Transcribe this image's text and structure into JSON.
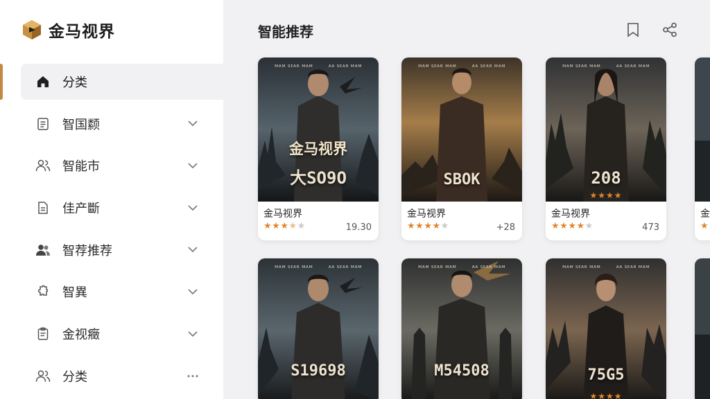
{
  "brand": {
    "name": "金马视界"
  },
  "sidebar": {
    "items": [
      {
        "label": "分类",
        "icon": "home-icon",
        "trail": "",
        "active": true
      },
      {
        "label": "智国颣",
        "icon": "document-icon",
        "trail": "chevron-down-icon"
      },
      {
        "label": "智能市",
        "icon": "users-icon",
        "trail": "chevron-down-icon"
      },
      {
        "label": "佳产斷",
        "icon": "file-icon",
        "trail": "chevron-down-icon"
      },
      {
        "label": "智荐推荐",
        "icon": "group-icon",
        "trail": "chevron-down-icon"
      },
      {
        "label": "智異",
        "icon": "puzzle-icon",
        "trail": "chevron-down-icon"
      },
      {
        "label": "金视癥",
        "icon": "clipboard-icon",
        "trail": "chevron-down-icon"
      },
      {
        "label": "分类",
        "icon": "users-icon",
        "trail": "more-icon"
      }
    ]
  },
  "main": {
    "title": "智能推荐",
    "cards": [
      {
        "title": "金马视界",
        "rating": 3.5,
        "count": "19.30",
        "poster_top_left": "ᴍᴀᴍ ꜱᴇᴀʀ ᴍᴀᴍ",
        "poster_top_right": "ᴀᴀ ꜱᴇᴀʀ ᴍᴀᴍ",
        "poster_cn": "金马视界",
        "poster_big": "大SO9O",
        "poster_stars": ""
      },
      {
        "title": "金马视界",
        "rating": 4,
        "count": "+28",
        "poster_top_left": "ᴍᴀᴍ ꜱᴇᴀʀ ᴍᴀᴍ",
        "poster_top_right": "ᴀᴀ ꜱᴇᴀʀ ᴍᴀᴍ",
        "poster_cn": "",
        "poster_big": "SBOK",
        "poster_stars": ""
      },
      {
        "title": "金马视界",
        "rating": 4,
        "count": "473",
        "poster_top_left": "ᴍᴀᴍ ꜱᴇᴀʀ ᴍᴀᴍ",
        "poster_top_right": "ᴀᴀ ꜱᴇᴀʀ ᴍᴀᴍ",
        "poster_cn": "",
        "poster_big": "208",
        "poster_stars": "★★★★"
      },
      {
        "title": "",
        "rating": 0,
        "count": "",
        "poster_top_left": "ᴍᴀᴍ ꜱᴇᴀʀ ᴍᴀᴍ",
        "poster_top_right": "ᴀᴀ ꜱᴇᴀʀ ᴍᴀᴍ",
        "poster_cn": "",
        "poster_big": "S19698",
        "poster_stars": ""
      },
      {
        "title": "",
        "rating": 0,
        "count": "",
        "poster_top_left": "ᴍᴀᴍ ꜱᴇᴀʀ ᴍᴀᴍ",
        "poster_top_right": "ᴀᴀ ꜱᴇᴀʀ ᴍᴀᴍ",
        "poster_cn": "",
        "poster_big": "M54508",
        "poster_stars": ""
      },
      {
        "title": "",
        "rating": 0,
        "count": "",
        "poster_top_left": "ᴍᴀᴍ ꜱᴇᴀʀ ᴍᴀᴍ",
        "poster_top_right": "ᴀᴀ ꜱᴇᴀʀ ᴍᴀᴍ",
        "poster_cn": "",
        "poster_big": "75G5",
        "poster_stars": "★★★★"
      }
    ],
    "partial_card": {
      "title": "金"
    }
  },
  "colors": {
    "accent": "#c08a43",
    "star": "#e0862a",
    "star_empty": "#c9c9c9"
  }
}
